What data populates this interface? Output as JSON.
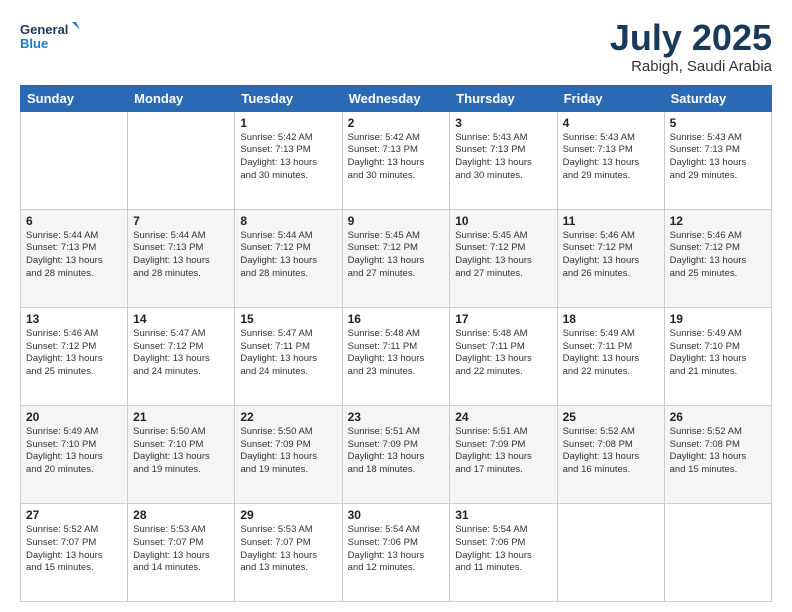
{
  "header": {
    "logo_line1": "General",
    "logo_line2": "Blue",
    "month": "July 2025",
    "location": "Rabigh, Saudi Arabia"
  },
  "days_of_week": [
    "Sunday",
    "Monday",
    "Tuesday",
    "Wednesday",
    "Thursday",
    "Friday",
    "Saturday"
  ],
  "weeks": [
    [
      {
        "day": "",
        "info": ""
      },
      {
        "day": "",
        "info": ""
      },
      {
        "day": "1",
        "info": "Sunrise: 5:42 AM\nSunset: 7:13 PM\nDaylight: 13 hours\nand 30 minutes."
      },
      {
        "day": "2",
        "info": "Sunrise: 5:42 AM\nSunset: 7:13 PM\nDaylight: 13 hours\nand 30 minutes."
      },
      {
        "day": "3",
        "info": "Sunrise: 5:43 AM\nSunset: 7:13 PM\nDaylight: 13 hours\nand 30 minutes."
      },
      {
        "day": "4",
        "info": "Sunrise: 5:43 AM\nSunset: 7:13 PM\nDaylight: 13 hours\nand 29 minutes."
      },
      {
        "day": "5",
        "info": "Sunrise: 5:43 AM\nSunset: 7:13 PM\nDaylight: 13 hours\nand 29 minutes."
      }
    ],
    [
      {
        "day": "6",
        "info": "Sunrise: 5:44 AM\nSunset: 7:13 PM\nDaylight: 13 hours\nand 28 minutes."
      },
      {
        "day": "7",
        "info": "Sunrise: 5:44 AM\nSunset: 7:13 PM\nDaylight: 13 hours\nand 28 minutes."
      },
      {
        "day": "8",
        "info": "Sunrise: 5:44 AM\nSunset: 7:12 PM\nDaylight: 13 hours\nand 28 minutes."
      },
      {
        "day": "9",
        "info": "Sunrise: 5:45 AM\nSunset: 7:12 PM\nDaylight: 13 hours\nand 27 minutes."
      },
      {
        "day": "10",
        "info": "Sunrise: 5:45 AM\nSunset: 7:12 PM\nDaylight: 13 hours\nand 27 minutes."
      },
      {
        "day": "11",
        "info": "Sunrise: 5:46 AM\nSunset: 7:12 PM\nDaylight: 13 hours\nand 26 minutes."
      },
      {
        "day": "12",
        "info": "Sunrise: 5:46 AM\nSunset: 7:12 PM\nDaylight: 13 hours\nand 25 minutes."
      }
    ],
    [
      {
        "day": "13",
        "info": "Sunrise: 5:46 AM\nSunset: 7:12 PM\nDaylight: 13 hours\nand 25 minutes."
      },
      {
        "day": "14",
        "info": "Sunrise: 5:47 AM\nSunset: 7:12 PM\nDaylight: 13 hours\nand 24 minutes."
      },
      {
        "day": "15",
        "info": "Sunrise: 5:47 AM\nSunset: 7:11 PM\nDaylight: 13 hours\nand 24 minutes."
      },
      {
        "day": "16",
        "info": "Sunrise: 5:48 AM\nSunset: 7:11 PM\nDaylight: 13 hours\nand 23 minutes."
      },
      {
        "day": "17",
        "info": "Sunrise: 5:48 AM\nSunset: 7:11 PM\nDaylight: 13 hours\nand 22 minutes."
      },
      {
        "day": "18",
        "info": "Sunrise: 5:49 AM\nSunset: 7:11 PM\nDaylight: 13 hours\nand 22 minutes."
      },
      {
        "day": "19",
        "info": "Sunrise: 5:49 AM\nSunset: 7:10 PM\nDaylight: 13 hours\nand 21 minutes."
      }
    ],
    [
      {
        "day": "20",
        "info": "Sunrise: 5:49 AM\nSunset: 7:10 PM\nDaylight: 13 hours\nand 20 minutes."
      },
      {
        "day": "21",
        "info": "Sunrise: 5:50 AM\nSunset: 7:10 PM\nDaylight: 13 hours\nand 19 minutes."
      },
      {
        "day": "22",
        "info": "Sunrise: 5:50 AM\nSunset: 7:09 PM\nDaylight: 13 hours\nand 19 minutes."
      },
      {
        "day": "23",
        "info": "Sunrise: 5:51 AM\nSunset: 7:09 PM\nDaylight: 13 hours\nand 18 minutes."
      },
      {
        "day": "24",
        "info": "Sunrise: 5:51 AM\nSunset: 7:09 PM\nDaylight: 13 hours\nand 17 minutes."
      },
      {
        "day": "25",
        "info": "Sunrise: 5:52 AM\nSunset: 7:08 PM\nDaylight: 13 hours\nand 16 minutes."
      },
      {
        "day": "26",
        "info": "Sunrise: 5:52 AM\nSunset: 7:08 PM\nDaylight: 13 hours\nand 15 minutes."
      }
    ],
    [
      {
        "day": "27",
        "info": "Sunrise: 5:52 AM\nSunset: 7:07 PM\nDaylight: 13 hours\nand 15 minutes."
      },
      {
        "day": "28",
        "info": "Sunrise: 5:53 AM\nSunset: 7:07 PM\nDaylight: 13 hours\nand 14 minutes."
      },
      {
        "day": "29",
        "info": "Sunrise: 5:53 AM\nSunset: 7:07 PM\nDaylight: 13 hours\nand 13 minutes."
      },
      {
        "day": "30",
        "info": "Sunrise: 5:54 AM\nSunset: 7:06 PM\nDaylight: 13 hours\nand 12 minutes."
      },
      {
        "day": "31",
        "info": "Sunrise: 5:54 AM\nSunset: 7:06 PM\nDaylight: 13 hours\nand 11 minutes."
      },
      {
        "day": "",
        "info": ""
      },
      {
        "day": "",
        "info": ""
      }
    ]
  ]
}
